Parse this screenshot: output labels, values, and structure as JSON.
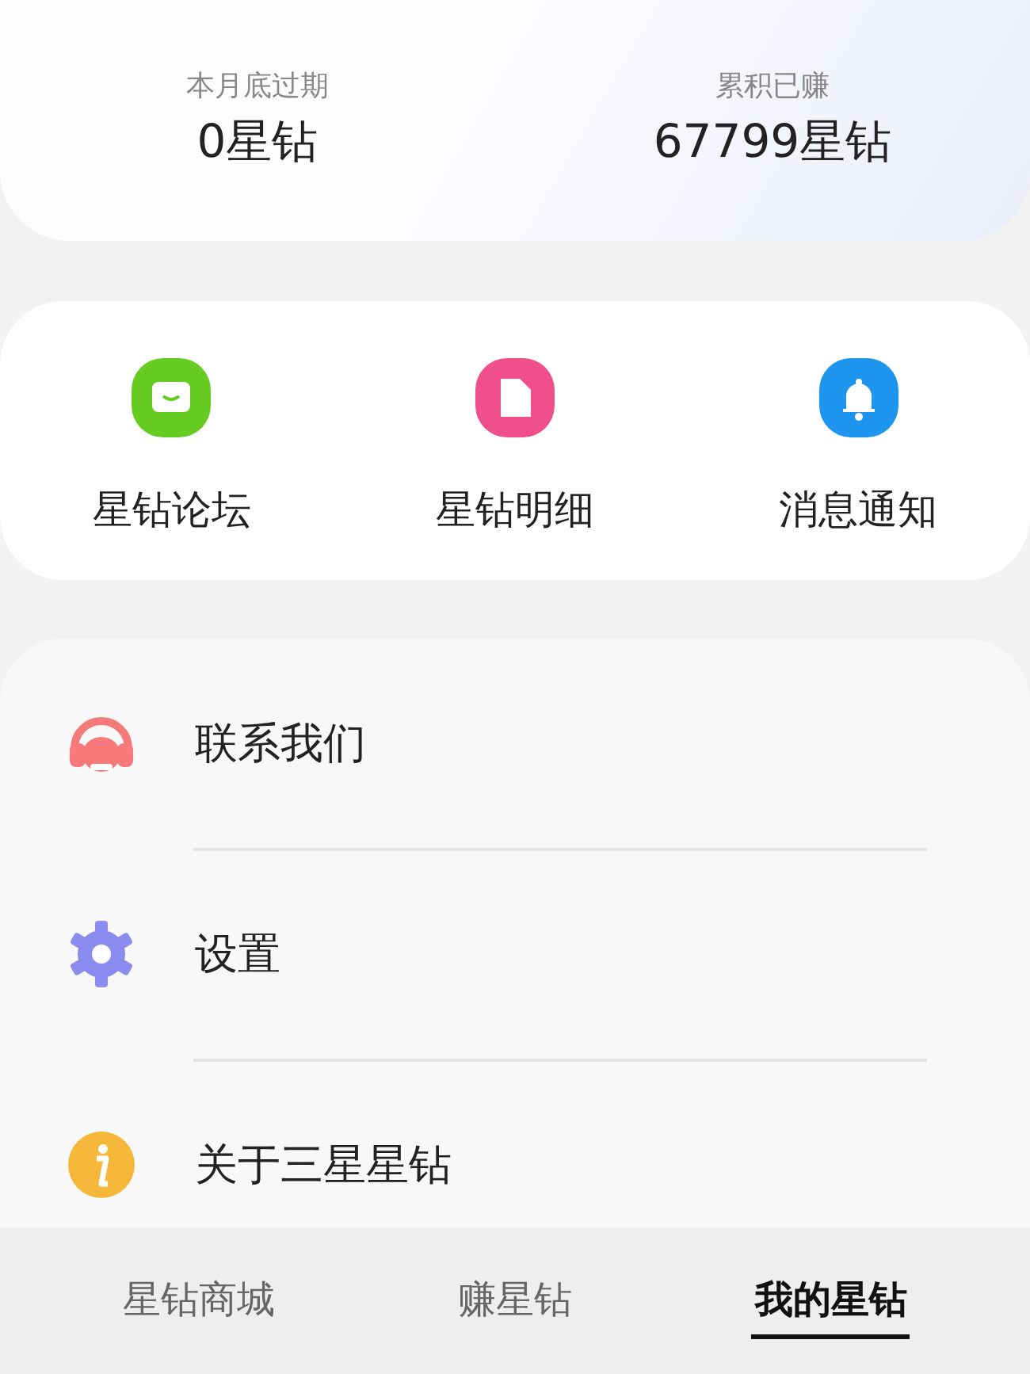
{
  "summary": [
    {
      "label": "本月底过期",
      "value": "0星钻"
    },
    {
      "label": "累积已赚",
      "value": "67799星钻"
    }
  ],
  "shortcuts": [
    {
      "label": "星钻论坛",
      "kind": "chat",
      "color": "#66cc22"
    },
    {
      "label": "星钻明细",
      "kind": "doc",
      "color": "#f0508a"
    },
    {
      "label": "消息通知",
      "kind": "bell",
      "color": "#1e96f0"
    }
  ],
  "menu": [
    {
      "label": "联系我们",
      "kind": "headset",
      "color": "#f77a7a"
    },
    {
      "label": "设置",
      "kind": "gear",
      "color": "#8a8cf0"
    },
    {
      "label": "关于三星星钻",
      "kind": "info",
      "color": "#f5b83a"
    }
  ],
  "tabs": [
    {
      "label": "星钻商城",
      "selected": false
    },
    {
      "label": "赚星钻",
      "selected": false
    },
    {
      "label": "我的星钻",
      "selected": true
    }
  ]
}
